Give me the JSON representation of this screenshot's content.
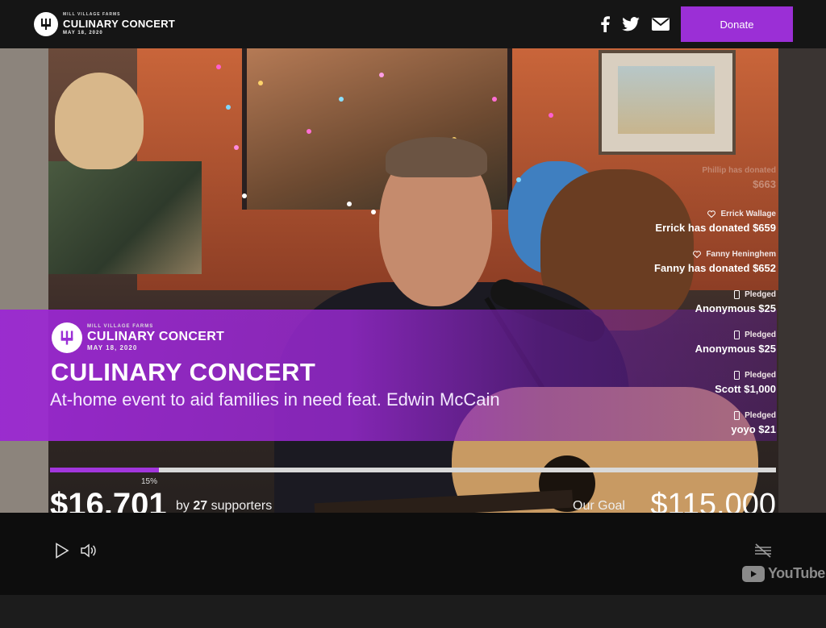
{
  "header": {
    "logo": {
      "small": "MILL VILLAGE FARMS",
      "title": "CULINARY CONCERT",
      "date": "MAY 18, 2020"
    },
    "social_icons": [
      "facebook-icon",
      "twitter-icon",
      "email-icon"
    ],
    "donate_label": "Donate"
  },
  "banner": {
    "logo": {
      "small": "MILL VILLAGE FARMS",
      "title": "CULINARY CONCERT",
      "date": "MAY 18, 2020"
    },
    "title": "CULINARY CONCERT",
    "subtitle": "At-home event to aid families in need feat. Edwin McCain"
  },
  "feed": [
    {
      "icon": "",
      "meta": "Phillip has donated",
      "text": "$663",
      "faded": true
    },
    {
      "icon": "heart-icon",
      "meta": "Errick Wallage",
      "text": "Errick has donated $659"
    },
    {
      "icon": "heart-icon",
      "meta": "Fanny Heninghem",
      "text": "Fanny has donated $652"
    },
    {
      "icon": "phone-icon",
      "meta": "Pledged",
      "text": "Anonymous $25"
    },
    {
      "icon": "phone-icon",
      "meta": "Pledged",
      "text": "Anonymous $25"
    },
    {
      "icon": "phone-icon",
      "meta": "Pledged",
      "text": "Scott $1,000"
    },
    {
      "icon": "phone-icon",
      "meta": "Pledged",
      "text": "yoyo $21"
    }
  ],
  "progress": {
    "percent_label": "15%",
    "fraction": 0.15,
    "raised": "$16,701",
    "by": "by",
    "supporters_count": "27",
    "supporters_label": "supporters",
    "goal_label": "Our Goal",
    "goal": "$115,000"
  },
  "player": {
    "icons": [
      "play-icon",
      "volume-icon",
      "captions-off-icon"
    ],
    "brand": "YouTube"
  },
  "colors": {
    "accent": "#9b2fd6",
    "topbar": "#151515",
    "progress_track": "#d9d9d9"
  }
}
